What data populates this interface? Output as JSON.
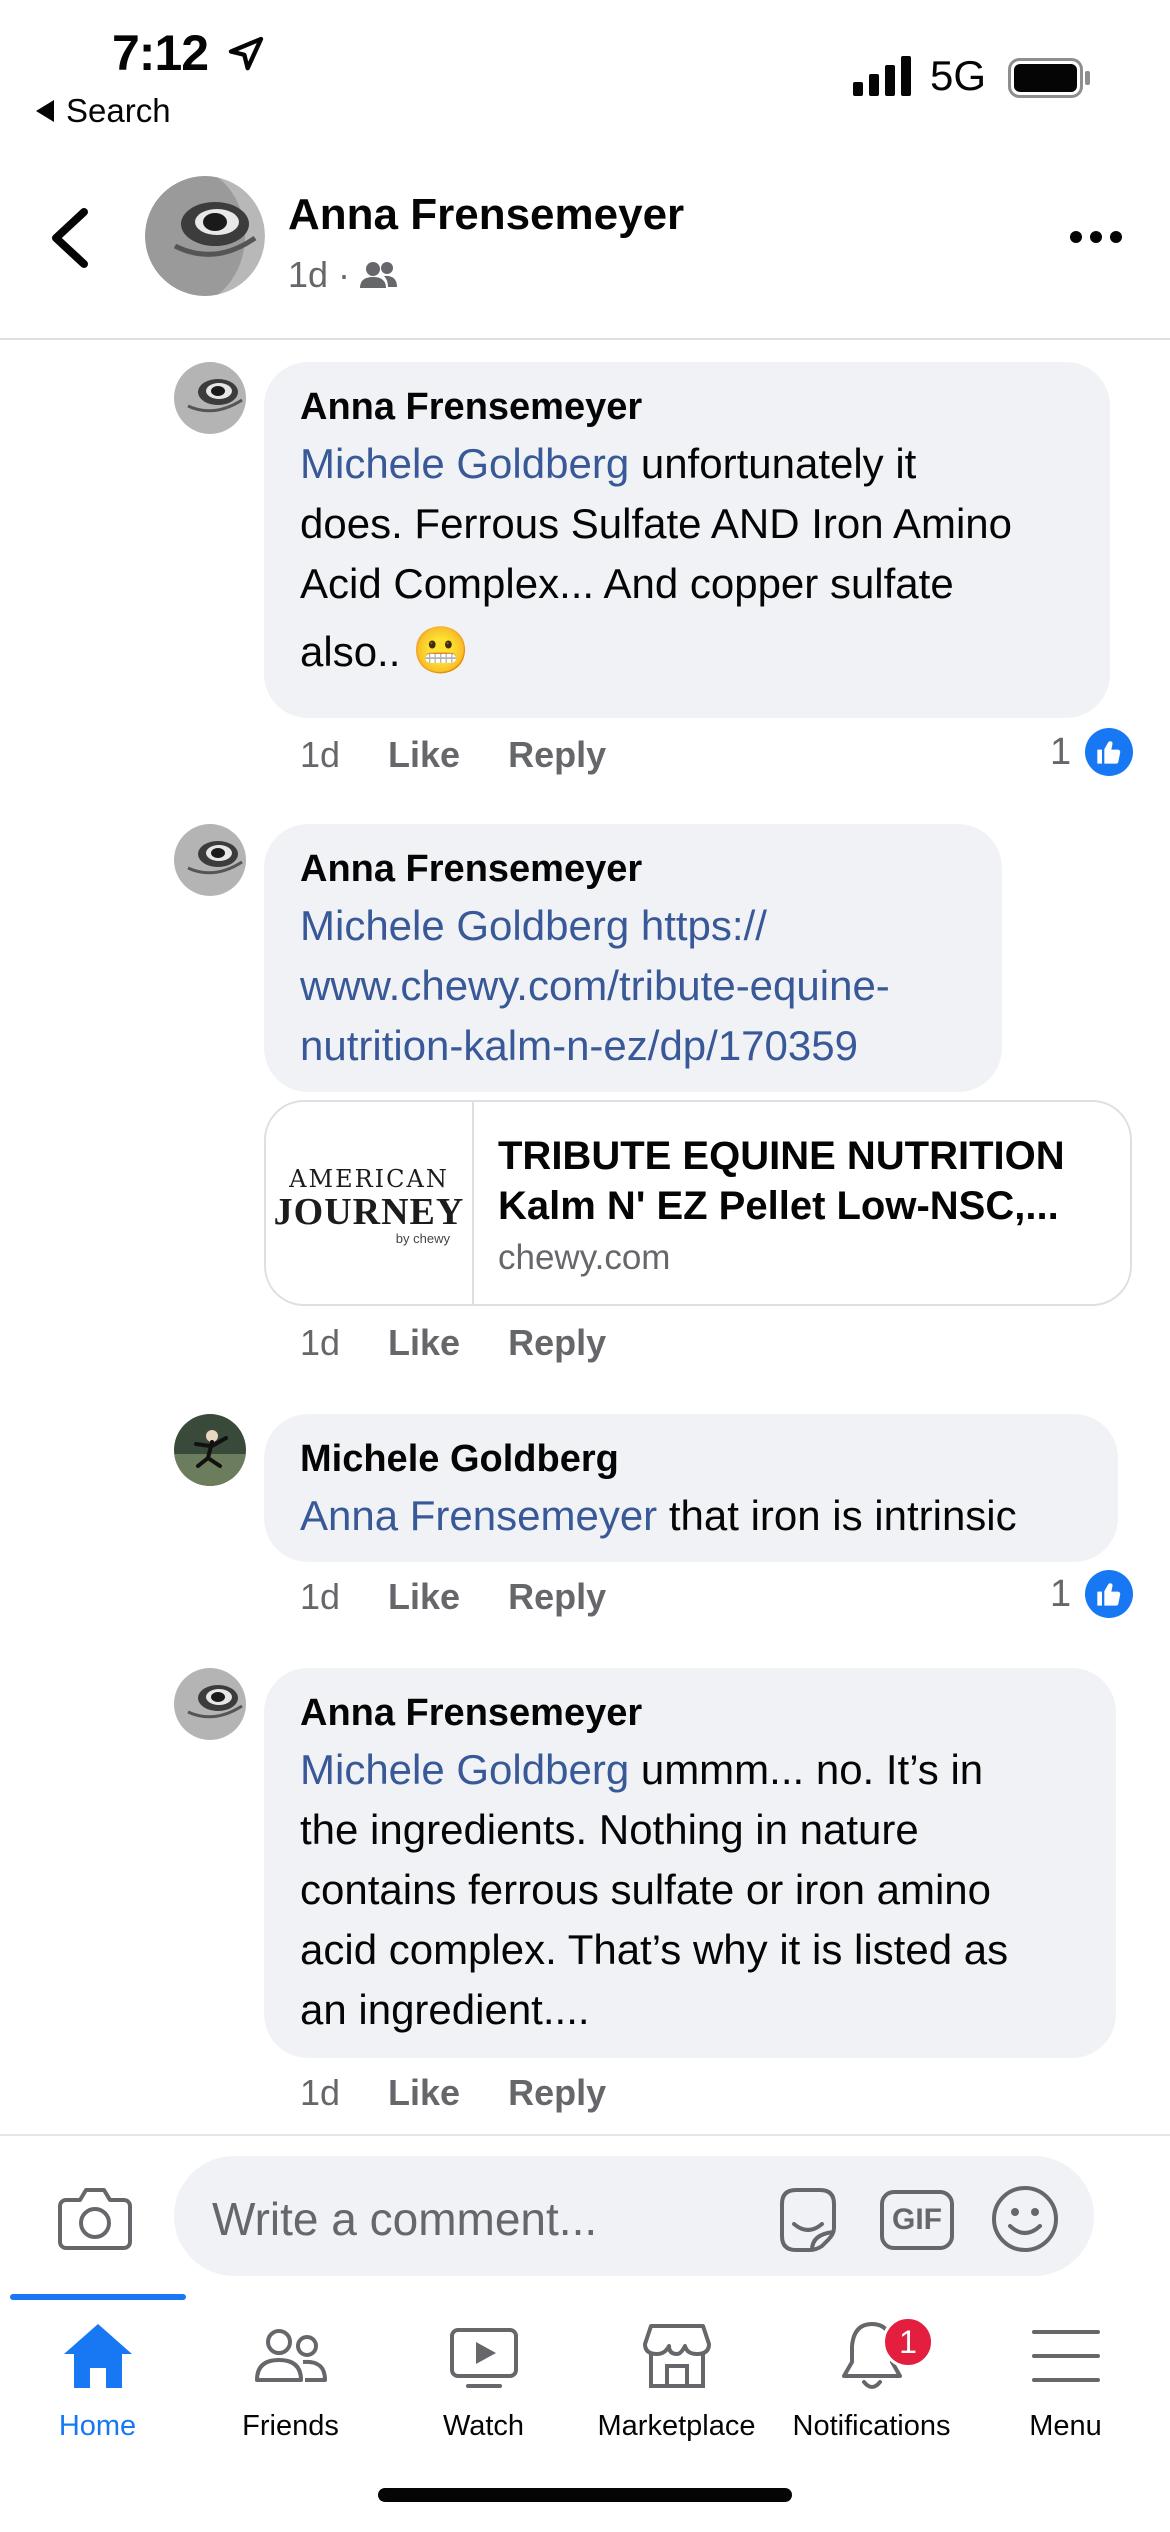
{
  "status_bar": {
    "time": "7:12",
    "back_label": "Search",
    "network": "5G"
  },
  "header": {
    "name": "Anna Frensemeyer",
    "time": "1d",
    "separator": "·"
  },
  "comments": [
    {
      "author": "Anna Frensemeyer",
      "mention": "Michele Goldberg",
      "text_line1": "  unfortunately it",
      "text_line2": "does. Ferrous Sulfate AND Iron Amino",
      "text_line3": "Acid Complex...  And copper sulfate",
      "text_line4": "also.. ",
      "emoji": "😬",
      "time": "1d",
      "like_label": "Like",
      "reply_label": "Reply",
      "reaction_count": "1"
    },
    {
      "author": "Anna Frensemeyer",
      "mention": "Michele Goldberg",
      "link_line1": " https://",
      "link_line2": "www.chewy.com/tribute-equine-",
      "link_line3": "nutrition-kalm-n-ez/dp/170359",
      "time": "1d",
      "like_label": "Like",
      "reply_label": "Reply",
      "preview": {
        "brand_top": "AMERICAN",
        "brand_bottom": "JOURNEY",
        "brand_sub": "by chewy",
        "title_line1": "TRIBUTE EQUINE NUTRITION",
        "title_line2": "Kalm N' EZ Pellet Low-NSC,...",
        "domain": "chewy.com"
      }
    },
    {
      "author": "Michele Goldberg",
      "mention": "Anna Frensemeyer",
      "text_line1": " that iron is intrinsic",
      "time": "1d",
      "like_label": "Like",
      "reply_label": "Reply",
      "reaction_count": "1"
    },
    {
      "author": "Anna Frensemeyer",
      "mention": "Michele Goldberg",
      "text_line1": " ummm... no. It’s in",
      "text_line2": "the ingredients. Nothing in nature",
      "text_line3": "contains ferrous sulfate or iron amino",
      "text_line4": "acid complex. That’s why it is listed as",
      "text_line5": "an ingredient....",
      "time": "1d",
      "like_label": "Like",
      "reply_label": "Reply"
    }
  ],
  "composer": {
    "placeholder": "Write a comment...",
    "gif_label": "GIF"
  },
  "tabs": [
    {
      "label": "Home",
      "icon": "home-icon",
      "active": true
    },
    {
      "label": "Friends",
      "icon": "friends-icon"
    },
    {
      "label": "Watch",
      "icon": "watch-icon"
    },
    {
      "label": "Marketplace",
      "icon": "marketplace-icon"
    },
    {
      "label": "Notifications",
      "icon": "bell-icon",
      "badge": "1"
    },
    {
      "label": "Menu",
      "icon": "menu-icon"
    }
  ],
  "colors": {
    "accent": "#1877f2",
    "mention": "#385898",
    "bubble": "#f0f2f5",
    "secondary_text": "#65676b",
    "badge": "#e41e3f"
  }
}
